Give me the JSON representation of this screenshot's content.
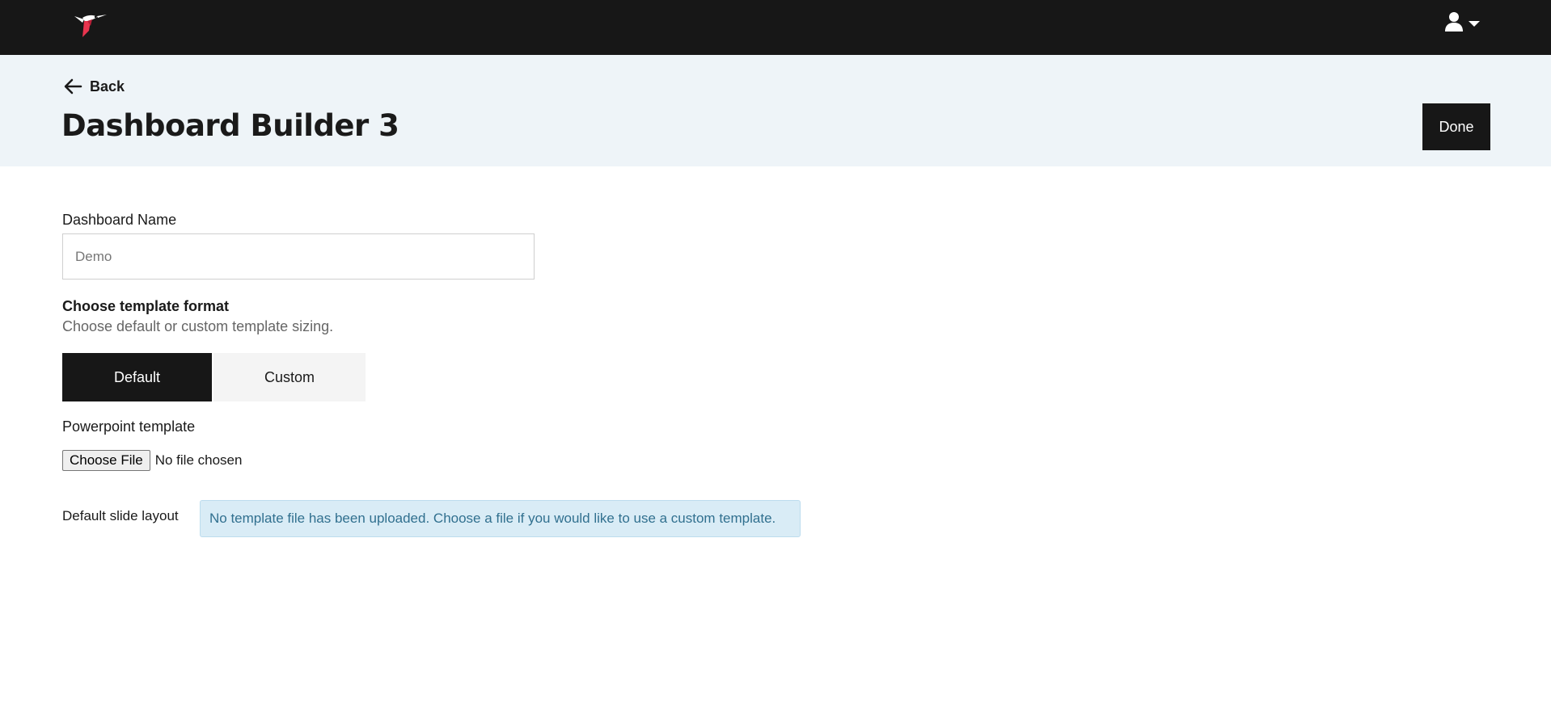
{
  "topbar": {
    "logo_icon": "hummingbird-logo-icon",
    "user_icon": "user-icon",
    "user_caret_icon": "caret-down-icon"
  },
  "header": {
    "back_label": "Back",
    "title": "Dashboard Builder 3",
    "done_label": "Done"
  },
  "form": {
    "name_label": "Dashboard Name",
    "name_placeholder": "Demo",
    "template_format_title": "Choose template format",
    "template_format_subtitle": "Choose default or custom template sizing.",
    "format_options": [
      "Default",
      "Custom"
    ],
    "selected_format": "Default",
    "ppt_label": "Powerpoint template",
    "file_button_label": "Choose File",
    "file_status": "No file chosen",
    "slide_layout_label": "Default slide layout",
    "alert_message": "No template file has been uploaded. Choose a file if you would like to use a custom template."
  },
  "colors": {
    "topbar_bg": "#171717",
    "header_bg": "#eef4f8",
    "accent_red": "#e8344e",
    "alert_bg": "#d9ecf6",
    "alert_text": "#31708f"
  }
}
